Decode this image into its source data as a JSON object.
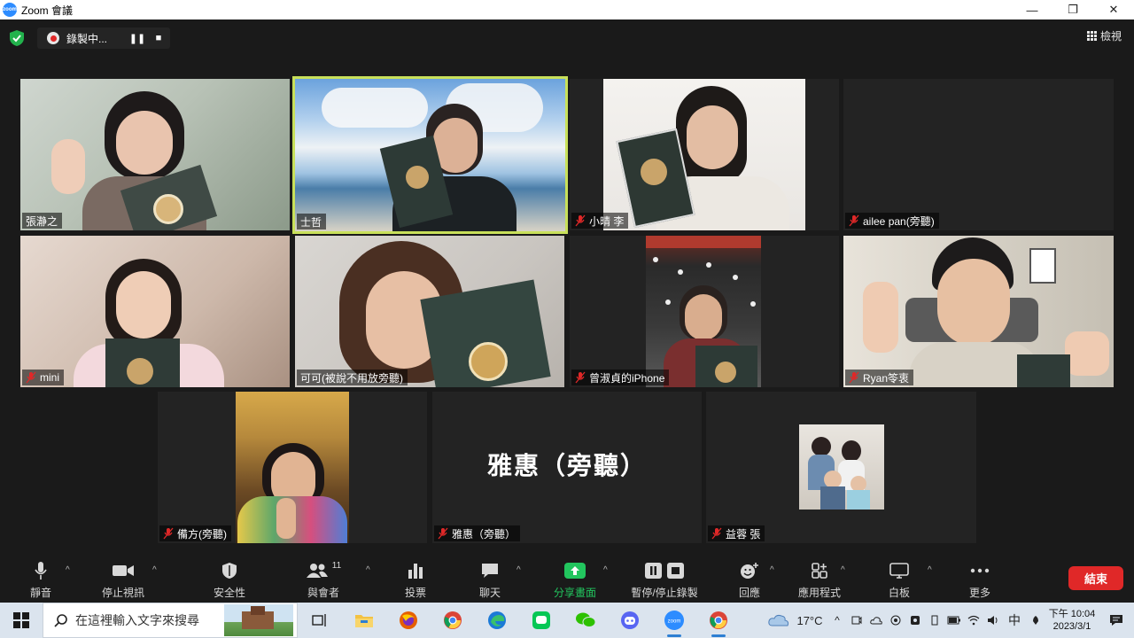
{
  "window": {
    "title": "Zoom 會議",
    "minimize": "—",
    "maximize": "❐",
    "close": "✕"
  },
  "recording": {
    "label": "錄製中...",
    "pause": "❚❚",
    "stop": "■"
  },
  "view_button": "檢視",
  "participants": [
    {
      "name": "張瀞之",
      "muted": false,
      "active": false
    },
    {
      "name": "士哲",
      "muted": false,
      "active": true
    },
    {
      "name": "小晴 李",
      "muted": true,
      "active": false
    },
    {
      "name": "ailee pan(旁聽)",
      "muted": true,
      "active": false
    },
    {
      "name": "mini",
      "muted": true,
      "active": false
    },
    {
      "name": "可可(被說不用放旁聽)",
      "muted": false,
      "active": false
    },
    {
      "name": "曾淑貞的iPhone",
      "muted": true,
      "active": false
    },
    {
      "name": "Ryan笭衷",
      "muted": true,
      "active": false
    },
    {
      "name": "備方(旁聽)",
      "muted": true,
      "active": false
    },
    {
      "name": "雅惠（旁聽）",
      "muted": true,
      "active": false,
      "video_off": true
    },
    {
      "name": "益蓉 張",
      "muted": true,
      "active": false
    }
  ],
  "toolbar": {
    "mute": "靜音",
    "stop_video": "停止視訊",
    "security": "安全性",
    "participants": "與會者",
    "participants_count": "11",
    "polls": "投票",
    "chat": "聊天",
    "share_screen": "分享畫面",
    "pause_stop_recording": "暫停/停止錄製",
    "reactions": "回應",
    "apps": "應用程式",
    "whiteboard": "白板",
    "more": "更多",
    "end": "結束"
  },
  "taskbar": {
    "search_placeholder": "在這裡輸入文字來搜尋",
    "weather": "17°C",
    "ime": "中",
    "time": "下午 10:04",
    "date": "2023/3/1"
  },
  "colors": {
    "active_speaker": "#c8e05a",
    "end_button": "#e02828",
    "share_button": "#22c55e",
    "muted_icon": "#e02828"
  }
}
